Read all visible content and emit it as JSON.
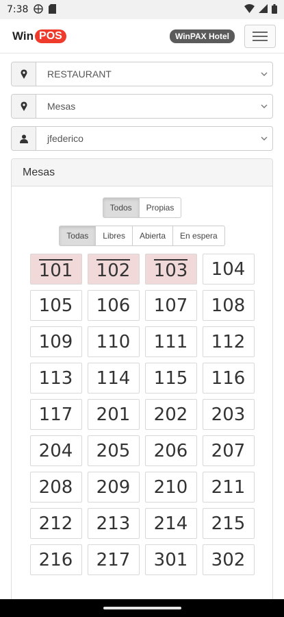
{
  "status": {
    "time": "7:38"
  },
  "header": {
    "logo_win": "Win",
    "logo_pos": "POS",
    "hotel": "WinPAX Hotel"
  },
  "selectors": {
    "location": "RESTAURANT",
    "area": "Mesas",
    "user": "jfederico"
  },
  "panel": {
    "title": "Mesas",
    "ownership_filter": [
      "Todos",
      "Propias"
    ],
    "status_filter": [
      "Todas",
      "Libres",
      "Abierta",
      "En espera"
    ],
    "tables": [
      "101",
      "102",
      "103",
      "104",
      "105",
      "106",
      "107",
      "108",
      "109",
      "110",
      "111",
      "112",
      "113",
      "114",
      "115",
      "116",
      "117",
      "201",
      "202",
      "203",
      "204",
      "205",
      "206",
      "207",
      "208",
      "209",
      "210",
      "211",
      "212",
      "213",
      "214",
      "215",
      "216",
      "217",
      "301",
      "302"
    ]
  },
  "colors": {
    "brand": "#ef3b2c",
    "open_table": "#f2d9d9"
  }
}
